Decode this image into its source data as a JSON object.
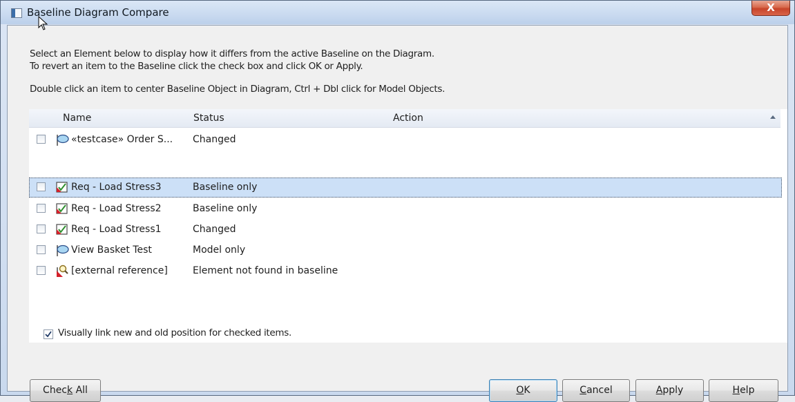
{
  "window": {
    "title": "Baseline Diagram Compare",
    "close_label": "X"
  },
  "instructions": {
    "line1": "Select an Element below to display how it differs from the active Baseline on the Diagram.",
    "line2": "To revert an item to the Baseline click the check box and click OK or Apply.",
    "line3": "Double click an item to center Baseline Object in Diagram, Ctrl + Dbl click for Model Objects."
  },
  "list": {
    "columns": {
      "name": "Name",
      "status": "Status",
      "action": "Action"
    },
    "rows": [
      {
        "name": "«testcase» Order S...",
        "status": "Changed",
        "action": "",
        "icon": "testcase-icon",
        "checked": false,
        "selected": false
      },
      {
        "name": "Req - Load Stress3",
        "status": "Baseline only",
        "action": "",
        "icon": "requirement-icon",
        "checked": false,
        "selected": true
      },
      {
        "name": "Req - Load Stress2",
        "status": "Baseline only",
        "action": "",
        "icon": "requirement-icon",
        "checked": false,
        "selected": false
      },
      {
        "name": "Req - Load Stress1",
        "status": "Changed",
        "action": "",
        "icon": "requirement-icon",
        "checked": false,
        "selected": false
      },
      {
        "name": "View Basket Test",
        "status": "Model only",
        "action": "",
        "icon": "testcase-icon",
        "checked": false,
        "selected": false
      },
      {
        "name": "[external reference]",
        "status": "Element not found in baseline",
        "action": "",
        "icon": "external-reference-icon",
        "checked": false,
        "selected": false
      }
    ]
  },
  "options": {
    "visual_link_label": "Visually link new and old position for checked items.",
    "visual_link_checked": true
  },
  "buttons": {
    "check_all": {
      "pre": "Chec",
      "key": "k",
      "post": " All"
    },
    "ok": {
      "pre": "",
      "key": "O",
      "post": "K"
    },
    "cancel": {
      "pre": "",
      "key": "C",
      "post": "ancel"
    },
    "apply": {
      "pre": "",
      "key": "A",
      "post": "pply"
    },
    "help": {
      "pre": "",
      "key": "H",
      "post": "elp"
    }
  },
  "colors": {
    "selection": "#cce0f7",
    "close_button": "#c7442a",
    "title_bar": "#c9daf0"
  }
}
